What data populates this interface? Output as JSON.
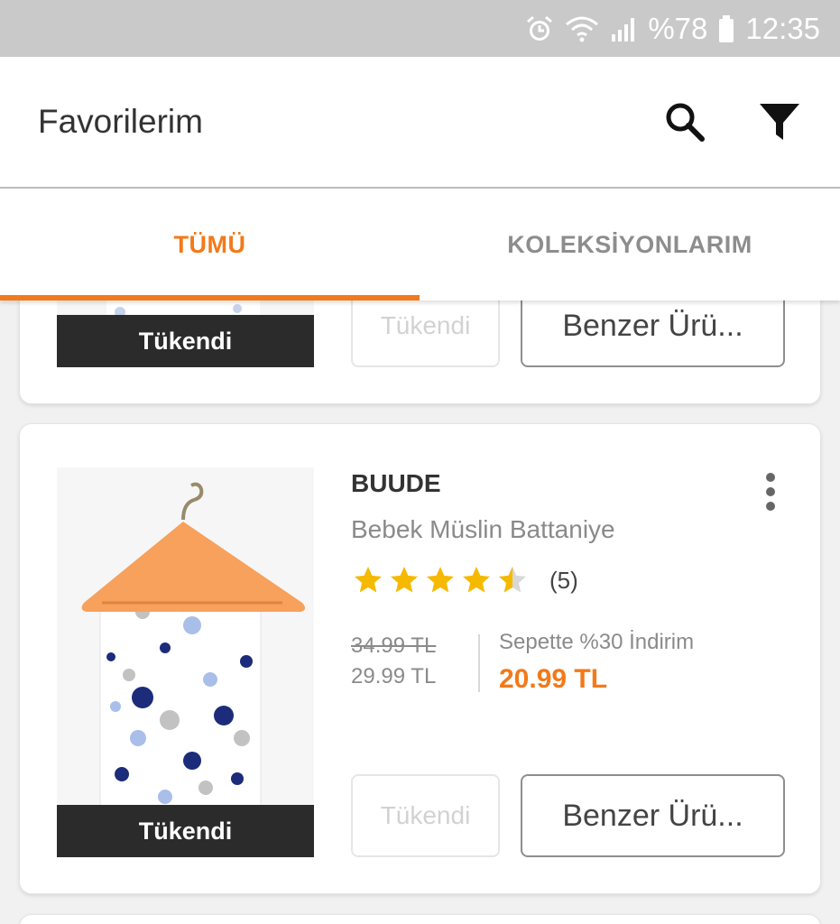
{
  "status_bar": {
    "battery": "%78",
    "time": "12:35"
  },
  "header": {
    "title": "Favorilerim",
    "search_icon": "search-icon",
    "filter_icon": "filter-icon"
  },
  "tabs": [
    {
      "label": "TÜMÜ",
      "active": true
    },
    {
      "label": "KOLEKSİYONLARIM",
      "active": false
    }
  ],
  "colors": {
    "accent": "#f27a1a",
    "star": "#f5b900",
    "soldout_band": "#2b2b2b"
  },
  "products": [
    {
      "soldout_label": "Tükendi",
      "soldout_button": "Tükendi",
      "similar_button": "Benzer Ürü..."
    },
    {
      "brand": "BUUDE",
      "name": "Bebek Müslin Battaniye",
      "rating": 4.5,
      "rating_count": "(5)",
      "old_price": "34.99 TL",
      "price": "29.99 TL",
      "discount_label": "Sepette %30 İndirim",
      "final_price": "20.99 TL",
      "soldout_label": "Tükendi",
      "soldout_button": "Tükendi",
      "similar_button": "Benzer Ürü..."
    }
  ]
}
